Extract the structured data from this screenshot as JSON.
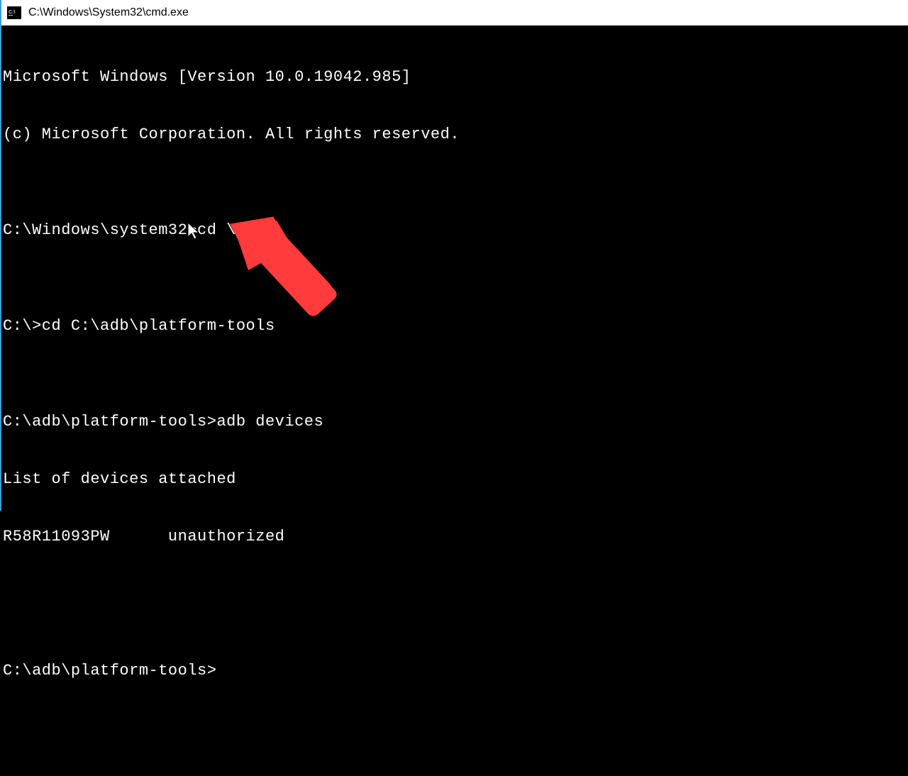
{
  "window": {
    "title": "C:\\Windows\\System32\\cmd.exe",
    "icon_label": "CMD"
  },
  "terminal": {
    "lines": [
      "Microsoft Windows [Version 10.0.19042.985]",
      "(c) Microsoft Corporation. All rights reserved.",
      "",
      "C:\\Windows\\system32>cd \\",
      "",
      "C:\\>cd C:\\adb\\platform-tools",
      "",
      "C:\\adb\\platform-tools>adb devices",
      "List of devices attached",
      "R58R11093PW      unauthorized",
      "",
      "",
      "C:\\adb\\platform-tools>"
    ]
  },
  "annotation": {
    "arrow_color": "#ff3b3b",
    "target": "unauthorized"
  }
}
